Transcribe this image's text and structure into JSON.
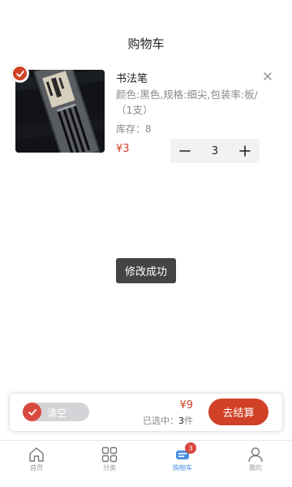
{
  "header": {
    "title": "购物车"
  },
  "cart_items": [
    {
      "selected": true,
      "name": "书法笔",
      "spec": "颜色:黑色,规格:细尖,包装率:板/（1支）",
      "stock": "库存：8",
      "price": "¥3",
      "quantity": "3"
    }
  ],
  "toast": {
    "message": "修改成功"
  },
  "checkout": {
    "clear_label": "清空",
    "total": "¥9",
    "selected_prefix": "已选中：",
    "selected_count": "3",
    "selected_suffix": "件",
    "checkout_label": "去结算"
  },
  "tabbar": {
    "items": [
      {
        "label": "首页",
        "icon": "home-icon"
      },
      {
        "label": "分类",
        "icon": "grid-icon"
      },
      {
        "label": "购物车",
        "icon": "cart-icon",
        "badge": "3",
        "active": true
      },
      {
        "label": "我的",
        "icon": "user-icon"
      }
    ]
  },
  "colors": {
    "accent": "#d04128",
    "tab_active": "#4a90e2",
    "muted_text": "#8a8a8a",
    "toast_bg": "#444444"
  }
}
